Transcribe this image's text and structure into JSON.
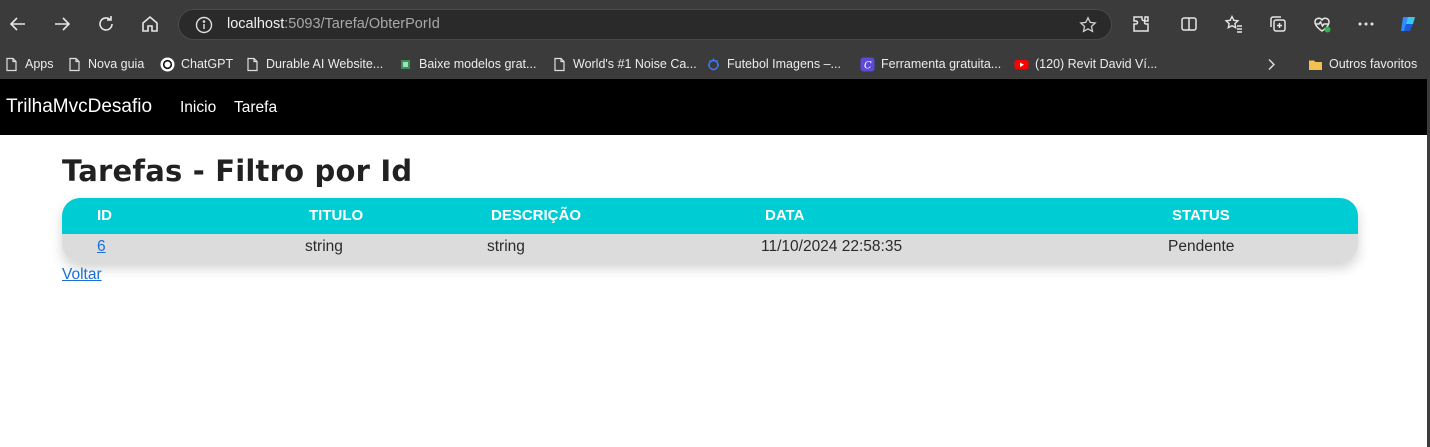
{
  "browser": {
    "url_host": "localhost",
    "url_path": ":5093/Tarefa/ObterPorId",
    "toolbar_icons": [
      "back-icon",
      "forward-icon",
      "refresh-icon",
      "home-icon",
      "info-icon",
      "star-icon",
      "extensions-icon",
      "split-screen-icon",
      "favorites-icon",
      "collections-icon",
      "health-icon",
      "more-icon",
      "copilot-icon"
    ]
  },
  "bookmarks": {
    "items": [
      {
        "label": "Apps",
        "icon": "page-icon"
      },
      {
        "label": "Nova guia",
        "icon": "page-icon"
      },
      {
        "label": "ChatGPT",
        "icon": "chatgpt-icon"
      },
      {
        "label": "Durable AI Website...",
        "icon": "page-icon"
      },
      {
        "label": "Baixe modelos grat...",
        "icon": "site-icon"
      },
      {
        "label": "World's #1 Noise Ca...",
        "icon": "page-icon"
      },
      {
        "label": "Futebol Imagens –...",
        "icon": "site-icon"
      },
      {
        "label": "Ferramenta gratuita...",
        "icon": "canva-icon"
      },
      {
        "label": "(120) Revit David Ví...",
        "icon": "youtube-icon"
      }
    ],
    "other_favorites": "Outros favoritos"
  },
  "navbar": {
    "brand": "TrilhaMvcDesafio",
    "links": [
      "Inicio",
      "Tarefa"
    ]
  },
  "main": {
    "title": "Tarefas - Filtro por Id",
    "table": {
      "headers": [
        "ID",
        "TITULO",
        "DESCRIÇÃO",
        "DATA",
        "STATUS"
      ],
      "rows": [
        [
          "6",
          "string",
          "string",
          "11/10/2024 22:58:35",
          "Pendente"
        ]
      ]
    },
    "back_link": "Voltar"
  },
  "colors": {
    "header_bg": "#00ccd4",
    "row_bg": "#dcdcdc",
    "navbar_bg": "#000000",
    "link": "#1a6fd6"
  }
}
